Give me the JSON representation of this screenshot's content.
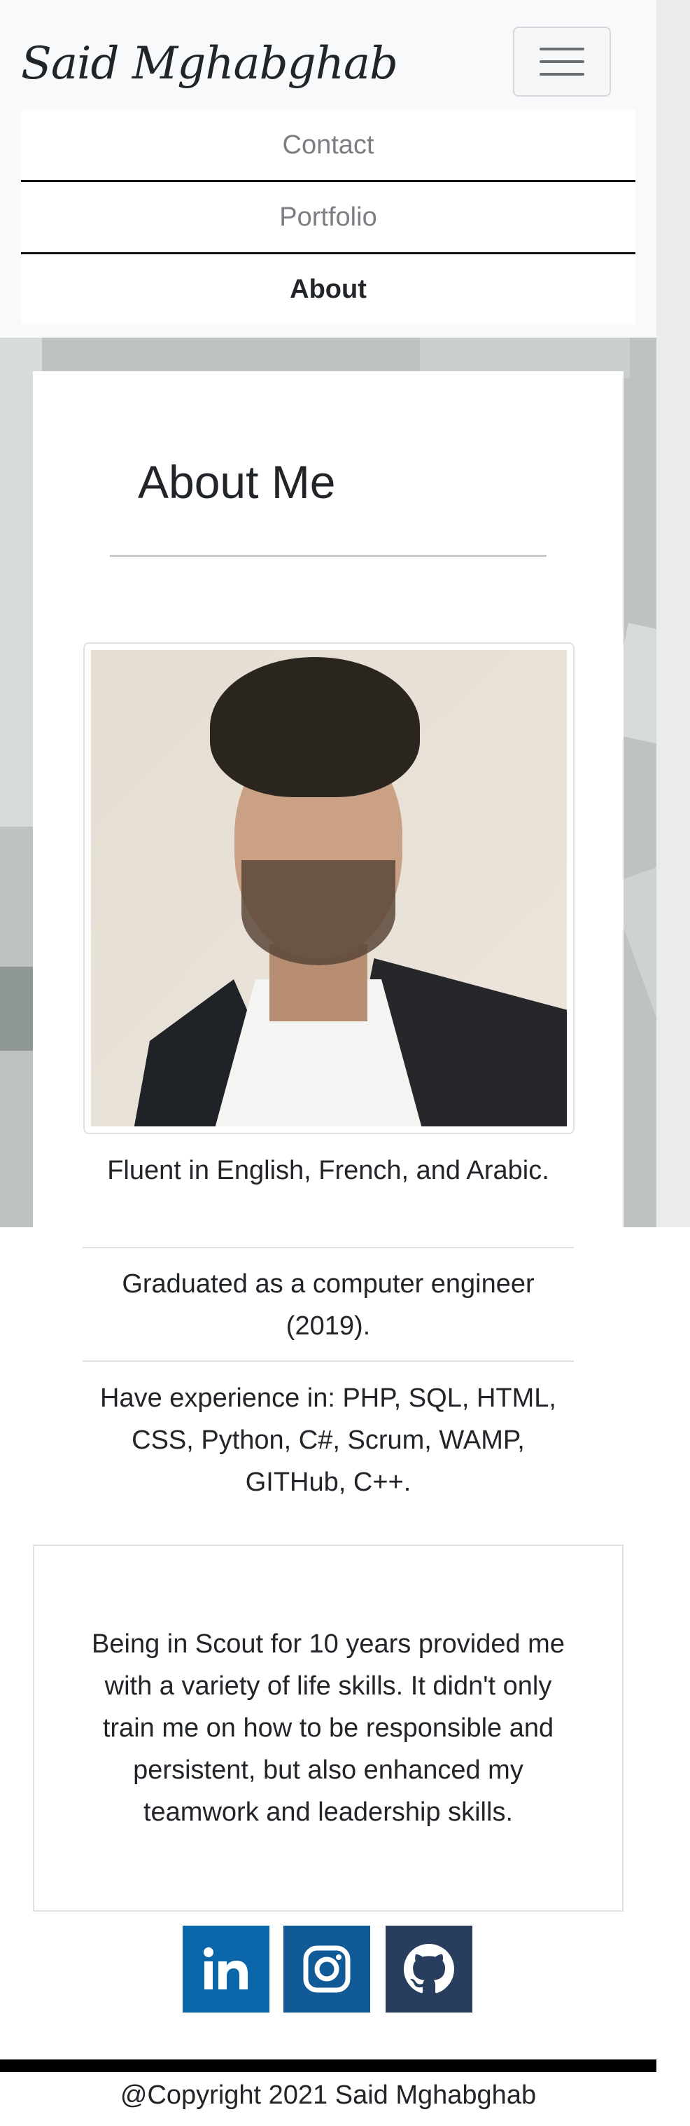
{
  "navbar": {
    "brand": "Said Mghabghab",
    "toggler_icon": "hamburger-menu-icon",
    "items": [
      {
        "label": "Contact",
        "active": false
      },
      {
        "label": "Portfolio",
        "active": false
      },
      {
        "label": "About",
        "active": true
      }
    ]
  },
  "about": {
    "title": "About Me",
    "photo_icon": "profile-photo",
    "info": [
      "Fluent in English, French, and Arabic.",
      "Graduated as a computer engineer (2019).",
      "Have experience in: PHP, SQL, HTML, CSS, Python, C#, Scrum, WAMP, GITHub, C++."
    ],
    "scout_text": "Being in Scout for 10 years provided me with a variety of life skills. It didn't only train me on how to be responsible and persistent, but also enhanced my teamwork and leadership skills."
  },
  "social": [
    {
      "name": "linkedin-icon",
      "color": "#0a66a8"
    },
    {
      "name": "instagram-icon",
      "color": "#0f5a97"
    },
    {
      "name": "github-icon",
      "color": "#283e5e"
    }
  ],
  "footer": {
    "copyright": "@Copyright 2021 Said Mghabghab"
  }
}
